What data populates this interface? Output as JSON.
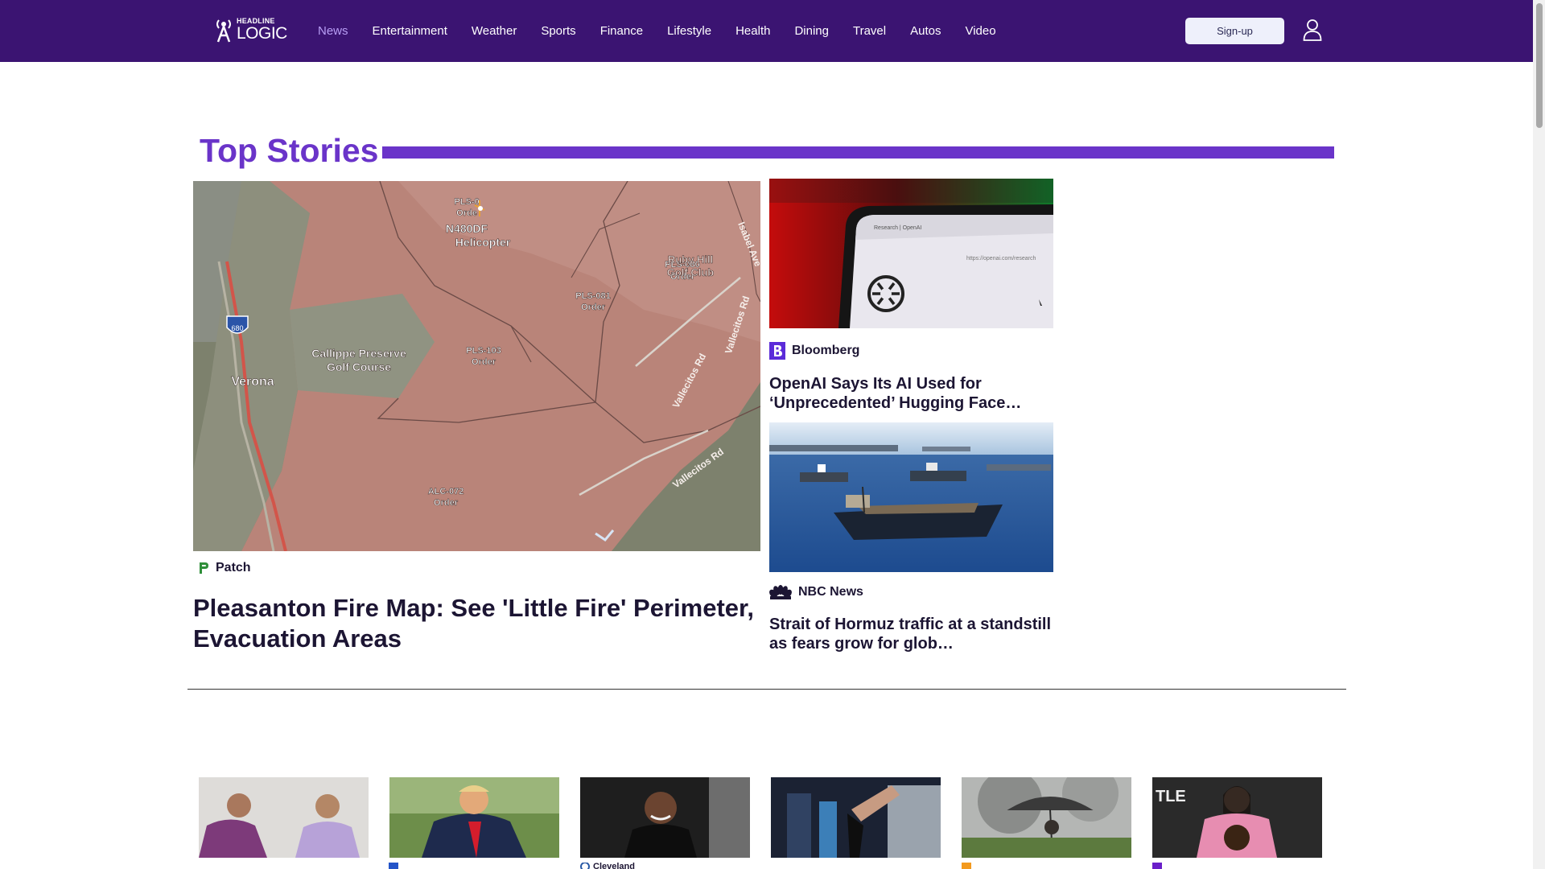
{
  "header": {
    "logo_top": "HEADLINE",
    "logo_bottom": "LOGIC",
    "nav": [
      "News",
      "Entertainment",
      "Weather",
      "Sports",
      "Finance",
      "Lifestyle",
      "Health",
      "Dining",
      "Travel",
      "Autos",
      "Video"
    ],
    "active_nav": "News",
    "signup_label": "Sign-up"
  },
  "colors": {
    "header_bg": "#3b1472",
    "accent": "#6a34c9",
    "active_nav": "#b89ef5"
  },
  "top_stories": {
    "title": "Top Stories",
    "main": {
      "source": "Patch",
      "headline": "Pleasanton Fire Map: See 'Little Fire' Perimeter, Evacuation Areas",
      "map_labels": {
        "heli_1": "N480DF",
        "heli_2": "Helicopter",
        "pls_top_1": "PLS-0",
        "pls_top_2": "Orde",
        "p081_1": "PLS-081",
        "p081_2": "Order",
        "p080_1": "PLS-080",
        "p080_2": "Order",
        "p103_1": "PLS-103",
        "p103_2": "Order",
        "a072_1": "ALC-072",
        "a072_2": "Order",
        "ruby_1": "Ruby Hill",
        "ruby_2": "Golf Club",
        "calippe_1": "Callippe Preserve",
        "calippe_2": "Golf Course",
        "verona": "Verona",
        "interstate": "680",
        "road_1": "Vallecitos Rd",
        "road_2": "Vallecitos Rd",
        "road_3": "Vallecitos Rd",
        "road_4": "Isabel Ave"
      }
    },
    "side": [
      {
        "source": "Bloomberg",
        "headline": "OpenAI Says Its AI Used for ‘Unprecedented’ Hugging Face…",
        "image_text_tab": "Research | OpenAI",
        "image_text_url": "https://openai.com/research"
      },
      {
        "source": "NBC News",
        "headline": "Strait of Hormuz traffic at a standstill as fears grow for glob…"
      }
    ]
  },
  "more_stories": {
    "sources": [
      "",
      "",
      "Cleveland",
      "",
      "",
      ""
    ]
  }
}
